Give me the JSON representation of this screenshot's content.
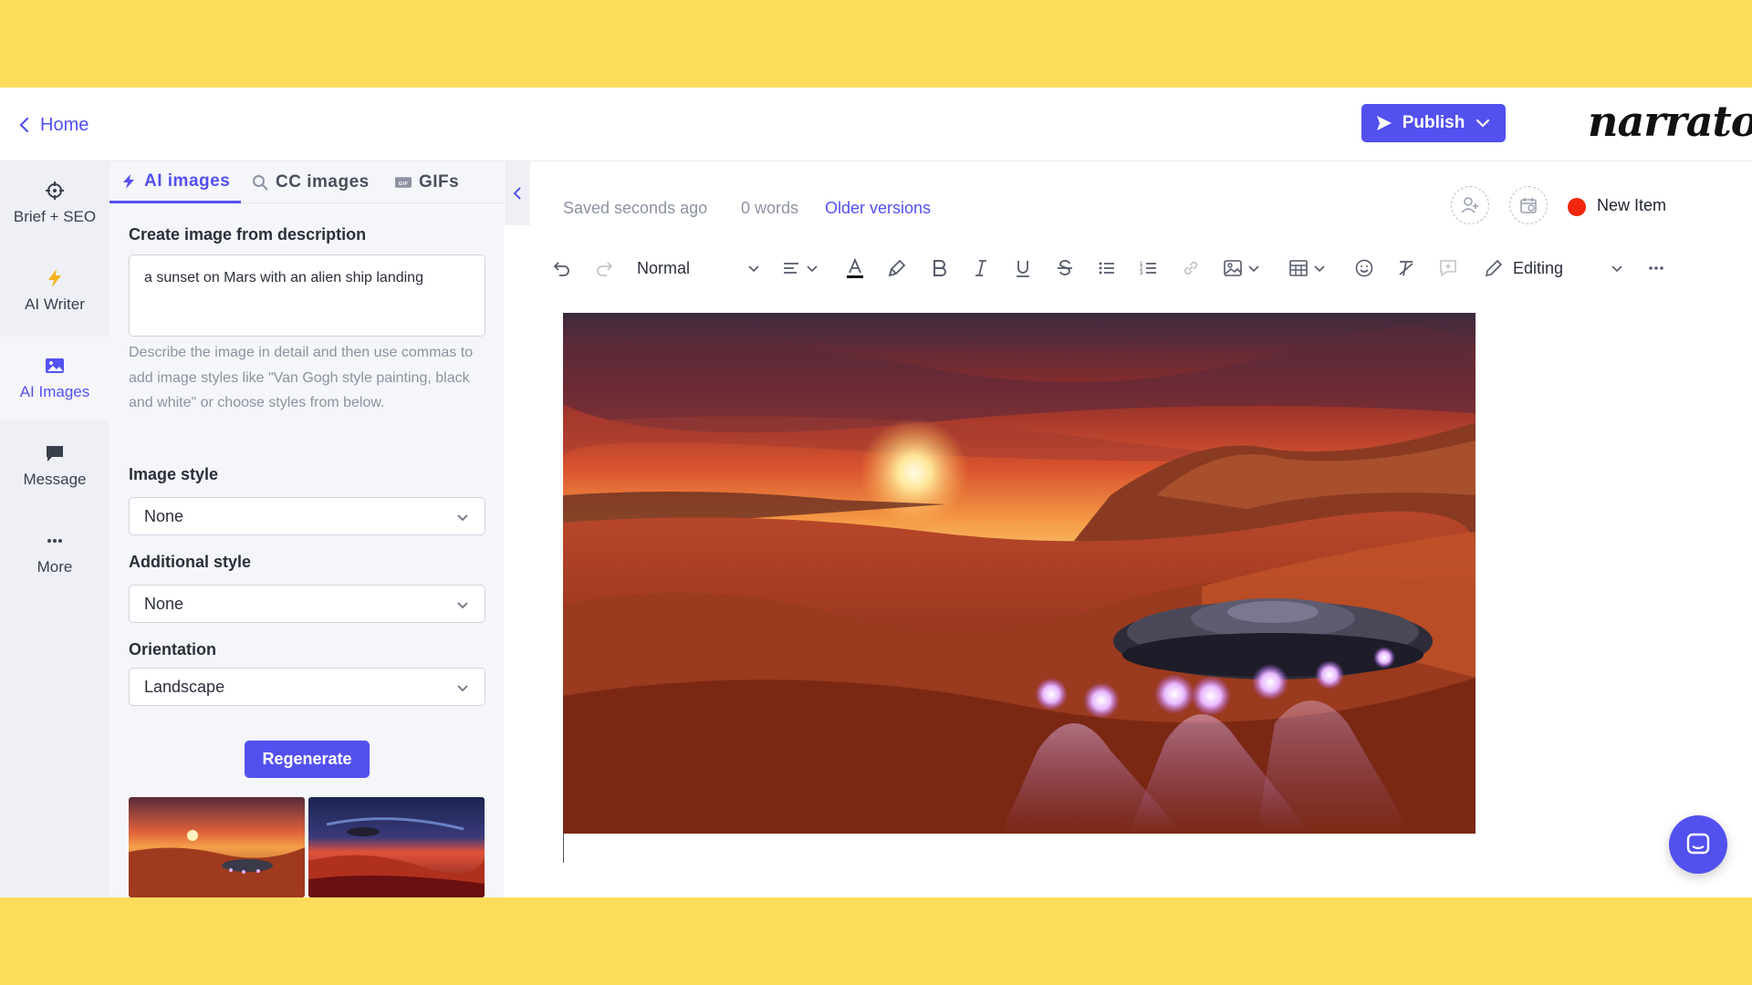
{
  "header": {
    "back_label": "Home",
    "publish_label": "Publish",
    "brand_name": "narrato"
  },
  "rail": {
    "items": [
      {
        "label": "Brief + SEO",
        "icon": "crosshair-icon"
      },
      {
        "label": "AI Writer",
        "icon": "lightning-icon"
      },
      {
        "label": "AI Images",
        "icon": "image-icon",
        "active": true
      },
      {
        "label": "Message",
        "icon": "chat-bubble-icon"
      },
      {
        "label": "More",
        "icon": "ellipsis-icon"
      }
    ]
  },
  "panel": {
    "tabs": [
      {
        "label": "AI images",
        "icon": "lightning-icon",
        "active": true
      },
      {
        "label": "CC images",
        "icon": "search-icon"
      },
      {
        "label": "GIFs",
        "icon": "gif-icon"
      }
    ],
    "description_label": "Create image from description",
    "description_value": "a sunset on Mars with an alien ship landing",
    "help_text": "Describe the image in detail and then use commas to add image styles like \"Van Gogh style painting, black and white\" or choose styles from below.",
    "image_style_label": "Image style",
    "image_style_value": "None",
    "additional_style_label": "Additional style",
    "additional_style_value": "None",
    "orientation_label": "Orientation",
    "orientation_value": "Landscape",
    "regenerate_label": "Regenerate"
  },
  "editor": {
    "saved_status": "Saved seconds ago",
    "word_count": "0 words",
    "older_versions_label": "Older versions",
    "item_status_color": "#f0260d",
    "item_label": "New Item",
    "toolbar": {
      "paragraph_style": "Normal",
      "mode": "Editing"
    }
  },
  "colors": {
    "accent": "#5350f0",
    "frame": "#FEDC5B"
  }
}
